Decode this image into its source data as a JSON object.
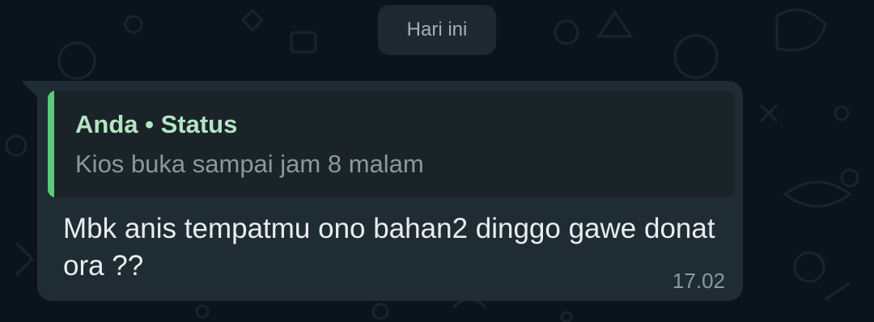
{
  "chat": {
    "date_separator": "Hari ini"
  },
  "message": {
    "quoted": {
      "author": "Anda",
      "separator": "•",
      "source": "Status",
      "text": "Kios buka sampai jam 8 malam"
    },
    "text": "Mbk anis tempatmu ono bahan2 dinggo gawe donat ora ??",
    "time": "17.02"
  },
  "colors": {
    "background": "#0b141a",
    "bubble": "#202c33",
    "quote_accent": "#5fc87c",
    "quote_author": "#b4e4c1"
  }
}
